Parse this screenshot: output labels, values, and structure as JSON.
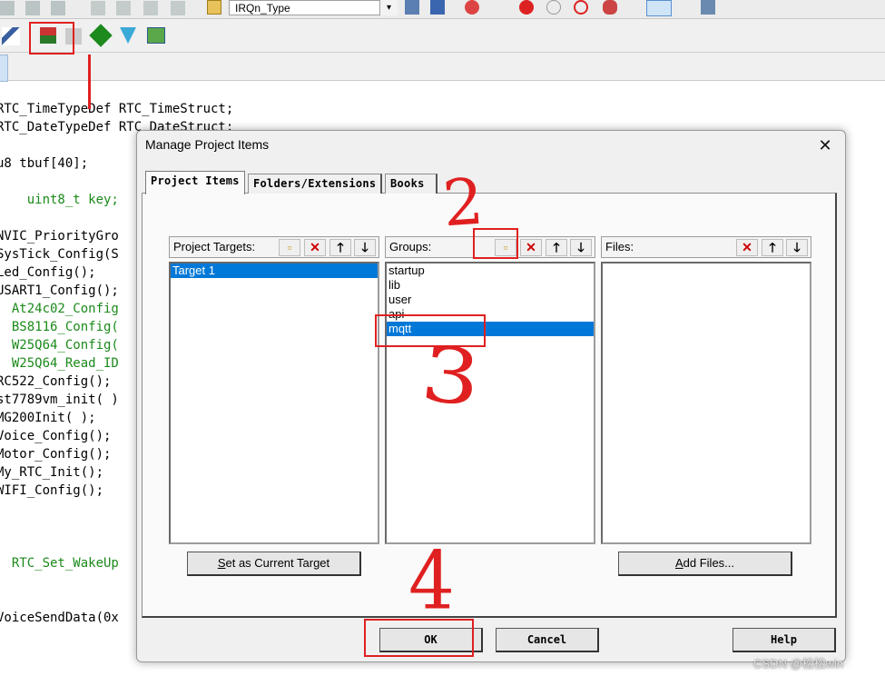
{
  "toolbar": {
    "target_combo_value": "IRQn_Type"
  },
  "editor": {
    "lines": [
      {
        "text": "RTC_TimeTypeDef RTC_TimeStruct;",
        "cls": ""
      },
      {
        "text": "RTC_DateTypeDef RTC_DateStruct;",
        "cls": ""
      },
      {
        "text": "",
        "cls": ""
      },
      {
        "text": "u8 tbuf[40];",
        "cls": ""
      },
      {
        "text": "",
        "cls": ""
      },
      {
        "text": "    uint8_t key;",
        "cls": "green"
      },
      {
        "text": "",
        "cls": ""
      },
      {
        "text": "NVIC_PriorityGro",
        "cls": ""
      },
      {
        "text": "SysTick_Config(S",
        "cls": ""
      },
      {
        "text": "Led_Config();",
        "cls": ""
      },
      {
        "text": "USART1_Config();",
        "cls": ""
      },
      {
        "text": "  At24c02_Config",
        "cls": "green"
      },
      {
        "text": "  BS8116_Config(",
        "cls": "green"
      },
      {
        "text": "  W25Q64_Config(",
        "cls": "green"
      },
      {
        "text": "  W25Q64_Read_ID",
        "cls": "green"
      },
      {
        "text": "RC522_Config();",
        "cls": ""
      },
      {
        "text": "st7789vm_init( )",
        "cls": ""
      },
      {
        "text": "MG200Init( );",
        "cls": ""
      },
      {
        "text": "Voice_Config();",
        "cls": ""
      },
      {
        "text": "Motor_Config();",
        "cls": ""
      },
      {
        "text": "My_RTC_Init();",
        "cls": ""
      },
      {
        "text": "WIFI_Config();",
        "cls": ""
      },
      {
        "text": "",
        "cls": ""
      },
      {
        "text": "",
        "cls": ""
      },
      {
        "text": "",
        "cls": ""
      },
      {
        "text": "  RTC_Set_WakeUp",
        "cls": "green"
      },
      {
        "text": "",
        "cls": ""
      },
      {
        "text": "",
        "cls": ""
      },
      {
        "text": "VoiceSendData(0x",
        "cls": ""
      }
    ]
  },
  "dialog": {
    "title": "Manage Project Items",
    "close_glyph": "✕",
    "tabs": [
      "Project Items",
      "Folders/Extensions",
      "Books"
    ],
    "targets": {
      "label": "Project Targets:",
      "items": [
        "Target 1"
      ],
      "selected_index": 0
    },
    "groups": {
      "label": "Groups:",
      "items": [
        "startup",
        "lib",
        "user",
        "api",
        "mqtt"
      ],
      "selected_index": 4
    },
    "files": {
      "label": "Files:",
      "items": []
    },
    "buttons": {
      "set_current_target_u": "S",
      "set_current_target_rest": "et as Current Target",
      "add_files_u": "A",
      "add_files_rest": "dd Files...",
      "ok": "OK",
      "cancel": "Cancel",
      "help": "Help"
    }
  },
  "annotations": {
    "step2": "2",
    "step3": "3",
    "step4": "4"
  },
  "watermark": "CSDN @松松win",
  "colors": {
    "selection": "#0078d7",
    "annotation_red": "#e02020",
    "code_green": "#1a8a1a"
  }
}
